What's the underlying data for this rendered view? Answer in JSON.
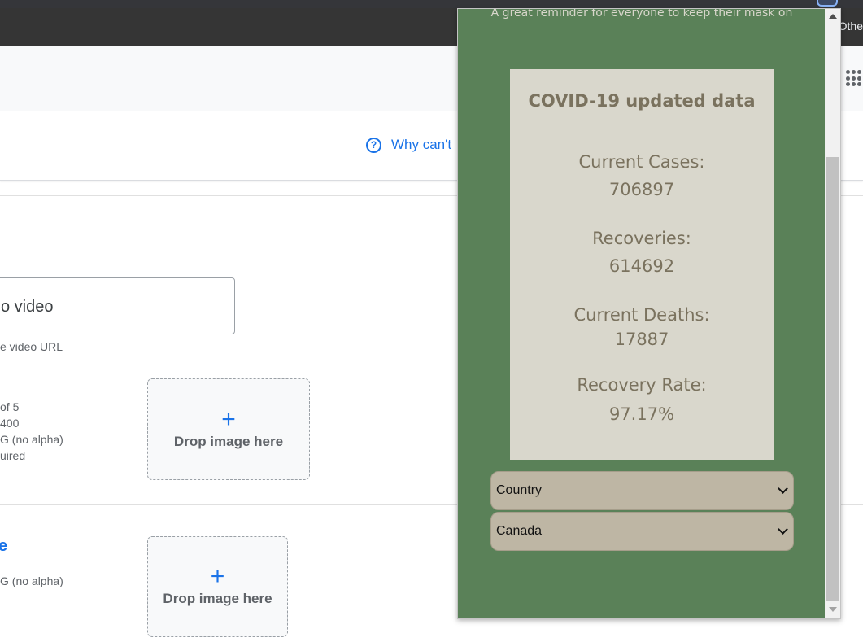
{
  "browser": {
    "bookmarks_other": "Othe"
  },
  "page": {
    "help_link": "Why can't",
    "help_icon": "?",
    "video_field_value": "o video",
    "video_field_helper": "e video URL",
    "screenshot_reqs": [
      "of 5",
      "400",
      "G (no alpha)",
      "uired"
    ],
    "section2_title": "e",
    "section2_reqs": [
      "G (no alpha)"
    ],
    "dropzone_plus": "+",
    "dropzone_label": "Drop image here"
  },
  "popup": {
    "tagline": "A great reminder for everyone to keep their mask on",
    "card": {
      "title": "COVID-19 updated data",
      "stats": [
        {
          "label": "Current Cases:",
          "value": "706897"
        },
        {
          "label": "Recoveries:",
          "value": "614692"
        },
        {
          "label": "Current Deaths:",
          "value": "17887"
        },
        {
          "label": "Recovery Rate:",
          "value": "97.17%"
        }
      ]
    },
    "selects": [
      {
        "selected": "Country"
      },
      {
        "selected": "Canada"
      }
    ]
  },
  "colors": {
    "popup_bg": "#5a8158",
    "card_bg": "#d9d7cc",
    "card_text": "#7a725e",
    "select_bg": "#beb6a4",
    "link": "#1a73e8"
  },
  "icons": [
    "help-icon",
    "apps-grid-icon",
    "extension-icon",
    "plus-icon",
    "chevron-down-icon",
    "scroll-up-icon",
    "scroll-down-icon"
  ]
}
